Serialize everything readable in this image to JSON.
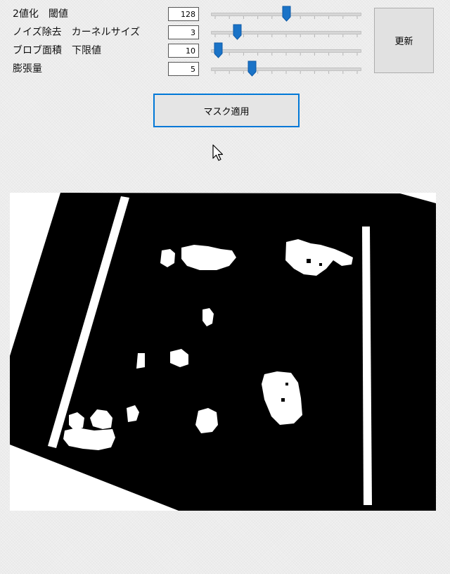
{
  "params": [
    {
      "label": "2値化　閾値",
      "value": "128",
      "level": 0.5
    },
    {
      "label": "ノイズ除去　カーネルサイズ",
      "value": "3",
      "level": 0.155
    },
    {
      "label": "ブロブ面積　下限値",
      "value": "10",
      "level": 0.02
    },
    {
      "label": "膨張量",
      "value": "5",
      "level": 0.26
    }
  ],
  "buttons": {
    "update_label": "更新",
    "apply_mask_label": "マスク適用"
  },
  "colors": {
    "accent": "#0078d7",
    "thumb": "#1a73c7",
    "mask_background": "#000000",
    "mask_foreground": "#ffffff"
  },
  "icons": {
    "cursor": "mouse-pointer-icon"
  }
}
